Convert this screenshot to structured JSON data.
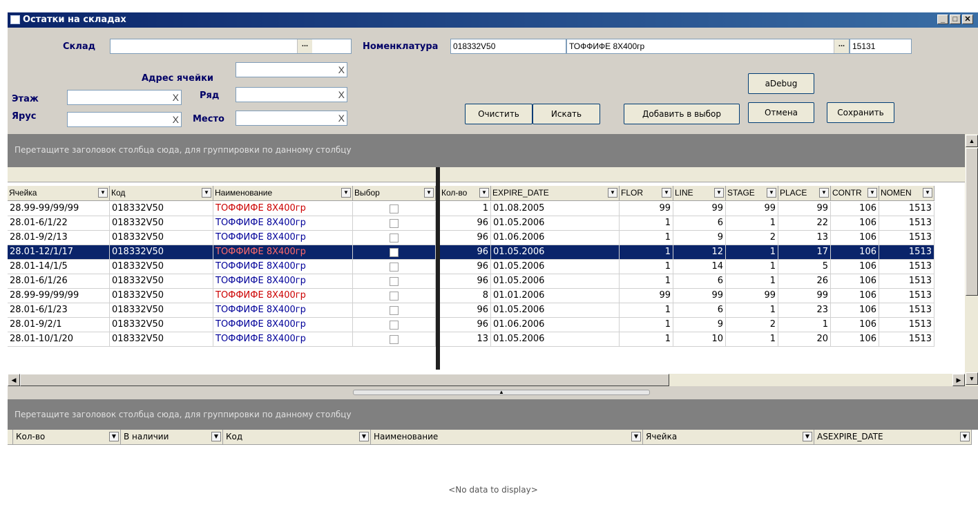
{
  "window": {
    "title": "Остатки на складах",
    "min": "_",
    "max": "□",
    "close": "✕"
  },
  "filters": {
    "sklad_label": "Склад",
    "sklad_value": "",
    "nomenklatura_label": "Номенклатура",
    "nom_code": "018332V50",
    "nom_name": "ТОФФИФЕ 8Х400гр",
    "nom_id": "15131",
    "address_label": "Адрес ячейки",
    "etazh_label": "Этаж",
    "ryad_label": "Ряд",
    "yarus_label": "Ярус",
    "mesto_label": "Место",
    "clear_glyph": "X",
    "dots_glyph": "...",
    "dots_small": "..."
  },
  "buttons": {
    "clear": "Очистить",
    "search": "Искать",
    "add_to_selection": "Добавить в выбор",
    "debug": "aDebug",
    "cancel": "Отмена",
    "save": "Сохранить"
  },
  "grid1": {
    "group_hint": "Перетащите заголовок столбца сюда, для группировки по данному столбцу",
    "columns": [
      "Ячейка",
      "Код",
      "Наименование",
      "Выбор",
      "Кол-во",
      "EXPIRE_DATE",
      "FLOR",
      "LINE",
      "STAGE",
      "PLACE",
      "CONTR",
      "NOMEN"
    ],
    "rows": [
      {
        "cell": "28.99-99/99/99",
        "code": "018332V50",
        "name": "ТОФФИФЕ 8Х400гр",
        "qty": "1",
        "expire": "01.08.2005",
        "flor": "99",
        "line": "99",
        "stage": "99",
        "place": "99",
        "contr": "106",
        "nomen": "1513"
      },
      {
        "cell": "28.01-6/1/22",
        "code": "018332V50",
        "name": "ТОФФИФЕ 8Х400гр",
        "qty": "96",
        "expire": "01.05.2006",
        "flor": "1",
        "line": "6",
        "stage": "1",
        "place": "22",
        "contr": "106",
        "nomen": "1513"
      },
      {
        "cell": "28.01-9/2/13",
        "code": "018332V50",
        "name": "ТОФФИФЕ 8Х400гр",
        "qty": "96",
        "expire": "01.06.2006",
        "flor": "1",
        "line": "9",
        "stage": "2",
        "place": "13",
        "contr": "106",
        "nomen": "1513"
      },
      {
        "cell": "28.01-12/1/17",
        "code": "018332V50",
        "name": "ТОФФИФЕ 8Х400гр",
        "qty": "96",
        "expire": "01.05.2006",
        "flor": "1",
        "line": "12",
        "stage": "1",
        "place": "17",
        "contr": "106",
        "nomen": "1513"
      },
      {
        "cell": "28.01-14/1/5",
        "code": "018332V50",
        "name": "ТОФФИФЕ 8Х400гр",
        "qty": "96",
        "expire": "01.05.2006",
        "flor": "1",
        "line": "14",
        "stage": "1",
        "place": "5",
        "contr": "106",
        "nomen": "1513"
      },
      {
        "cell": "28.01-6/1/26",
        "code": "018332V50",
        "name": "ТОФФИФЕ 8Х400гр",
        "qty": "96",
        "expire": "01.05.2006",
        "flor": "1",
        "line": "6",
        "stage": "1",
        "place": "26",
        "contr": "106",
        "nomen": "1513"
      },
      {
        "cell": "28.99-99/99/99",
        "code": "018332V50",
        "name": "ТОФФИФЕ 8Х400гр",
        "qty": "8",
        "expire": "01.01.2006",
        "flor": "99",
        "line": "99",
        "stage": "99",
        "place": "99",
        "contr": "106",
        "nomen": "1513"
      },
      {
        "cell": "28.01-6/1/23",
        "code": "018332V50",
        "name": "ТОФФИФЕ 8Х400гр",
        "qty": "96",
        "expire": "01.05.2006",
        "flor": "1",
        "line": "6",
        "stage": "1",
        "place": "23",
        "contr": "106",
        "nomen": "1513"
      },
      {
        "cell": "28.01-9/2/1",
        "code": "018332V50",
        "name": "ТОФФИФЕ 8Х400гр",
        "qty": "96",
        "expire": "01.06.2006",
        "flor": "1",
        "line": "9",
        "stage": "2",
        "place": "1",
        "contr": "106",
        "nomen": "1513"
      },
      {
        "cell": "28.01-10/1/20",
        "code": "018332V50",
        "name": "ТОФФИФЕ 8Х400гр",
        "qty": "13",
        "expire": "01.05.2006",
        "flor": "1",
        "line": "10",
        "stage": "1",
        "place": "20",
        "contr": "106",
        "nomen": "1513"
      }
    ],
    "name_colors": [
      "#cc0000",
      "#000099",
      "#000099",
      "#000099",
      "#000099",
      "#000099",
      "#cc0000",
      "#000099",
      "#000099",
      "#000099"
    ],
    "selected_row": 3
  },
  "grid2": {
    "group_hint": "Перетащите заголовок столбца сюда, для группировки по данному столбцу",
    "columns": [
      "Кол-во",
      "В наличии",
      "Код",
      "Наименование",
      "Ячейка",
      "ASEXPIRE_DATE"
    ],
    "empty_text": "<No data to display>"
  },
  "glyphs": {
    "dropdown": "▼",
    "up": "▲",
    "down": "▼",
    "left": "◀",
    "right": "▶",
    "splitter": "▲"
  }
}
